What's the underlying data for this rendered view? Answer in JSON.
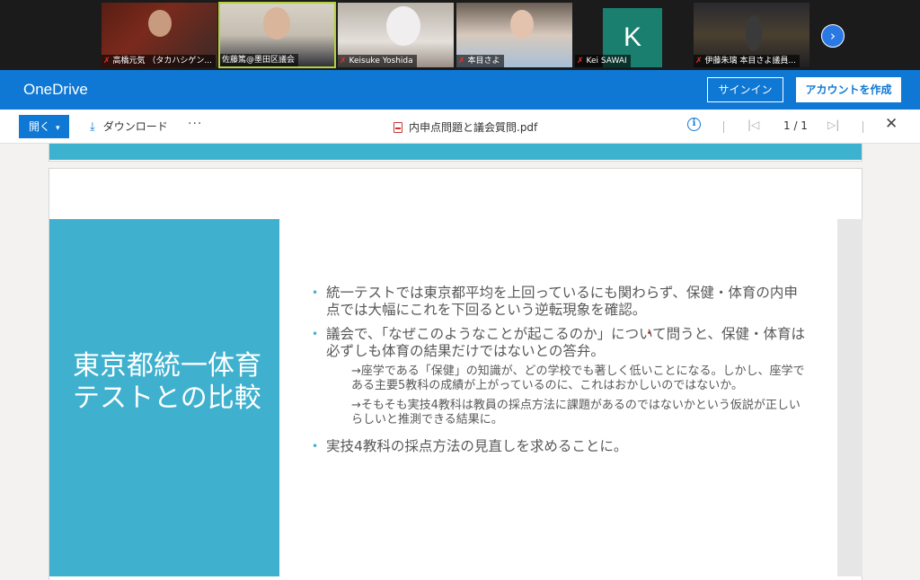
{
  "participants": [
    {
      "name": "高橋元気 （タカハシゲン...",
      "muted": true,
      "active": false
    },
    {
      "name": "佐藤篤@墨田区議会",
      "muted": false,
      "active": true
    },
    {
      "name": "Keisuke Yoshida",
      "muted": true,
      "active": false
    },
    {
      "name": "本目さよ",
      "muted": true,
      "active": false
    },
    {
      "name": "Kei SAWAI",
      "muted": true,
      "active": false,
      "initial": "K"
    },
    {
      "name": "伊藤朱璃 本目さよ議員...",
      "muted": true,
      "active": false
    }
  ],
  "strip": {
    "next_icon": "chevron-right-icon",
    "next_symbol": "›"
  },
  "header": {
    "brand": "OneDrive",
    "signin_label": "サインイン",
    "create_label": "アカウントを作成",
    "accent": "#0f78d4"
  },
  "toolbar": {
    "open_label": "開く",
    "download_label": "ダウンロード",
    "more_label": "···",
    "filename": "内申点問題と議会質問.pdf",
    "page_count": "1 / 1"
  },
  "slide": {
    "title": "東京都統一体育テストとの比較",
    "bullets": [
      "統一テストでは東京都平均を上回っているにも関わらず、保健・体育の内申点では大幅にこれを下回るという逆転現象を確認。",
      "議会で、「なぜこのようなことが起こるのか」について問うと、保健・体育は必ずしも体育の結果だけではないとの答弁。"
    ],
    "subs": [
      "→座学である「保健」の知識が、どの学校でも著しく低いことになる。しかし、座学である主要5教科の成績が上がっているのに、これはおかしいのではないか。",
      "→そもそも実技4教科は教員の採点方法に課題があるのではないかという仮説が正しいらしいと推測できる結果に。"
    ],
    "last_bullet": "実技4教科の採点方法の見直しを求めることに。",
    "panel_color": "#3fb1cf"
  }
}
